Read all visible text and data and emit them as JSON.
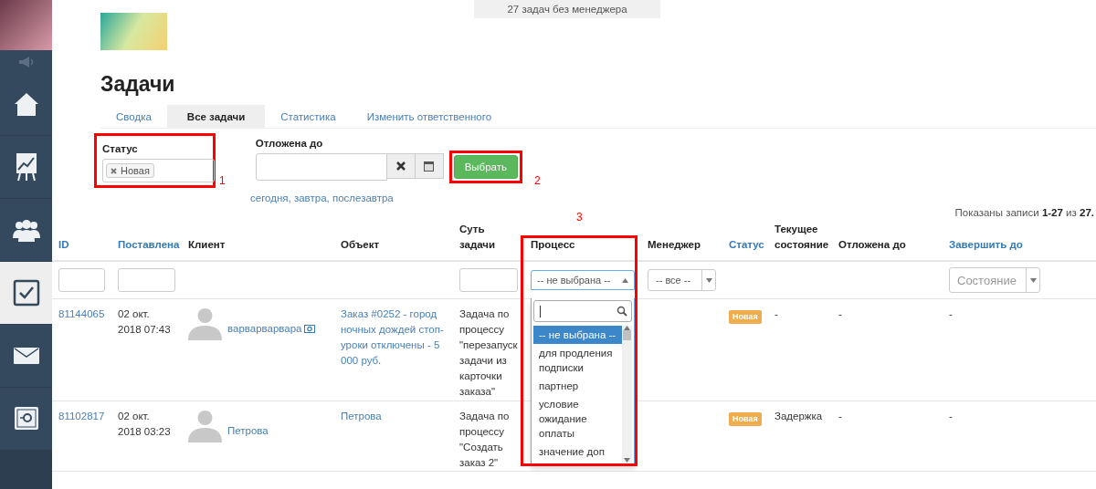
{
  "sidebar": {
    "items": [
      {
        "kind": "home",
        "selected": false
      },
      {
        "kind": "chart",
        "selected": false
      },
      {
        "kind": "people",
        "selected": false
      },
      {
        "kind": "tasks",
        "selected": true
      },
      {
        "kind": "mail",
        "selected": false
      },
      {
        "kind": "safe",
        "selected": false
      }
    ]
  },
  "banner": "27 задач без менеджера",
  "title": "Задачи",
  "tabs": [
    {
      "label": "Сводка",
      "selected": false
    },
    {
      "label": "Все задачи",
      "selected": true
    },
    {
      "label": "Статистика",
      "selected": false
    },
    {
      "label": "Изменить ответственного",
      "selected": false
    }
  ],
  "filters": {
    "status": {
      "label": "Статус",
      "tags": [
        "Новая"
      ]
    },
    "postponed": {
      "label": "Отложена до"
    },
    "button": "Выбрать",
    "quick_links": [
      "сегодня",
      "завтра",
      "послезавтра"
    ],
    "separator": ","
  },
  "records_info": "Показаны записи **1-27** из **27.**",
  "annotations": [
    "1",
    "2",
    "3"
  ],
  "table": {
    "columns": [
      {
        "label": "ID",
        "sortable": true,
        "kind": "input"
      },
      {
        "label": "Поставлена",
        "sortable": true,
        "kind": "input"
      },
      {
        "label": "Клиент",
        "sortable": false,
        "kind": "none"
      },
      {
        "label": "Объект",
        "sortable": false,
        "kind": "none"
      },
      {
        "label": "Суть задачи",
        "sortable": false,
        "kind": "input"
      },
      {
        "label": "Процесс",
        "sortable": false,
        "kind": "dropdown"
      },
      {
        "label": "Менеджер",
        "sortable": false,
        "kind": "select",
        "value": "-- все --"
      },
      {
        "label": "Статус",
        "sortable": true,
        "kind": "none"
      },
      {
        "label": "Текущее состояние",
        "sortable": false,
        "kind": "none"
      },
      {
        "label": "Отложена до",
        "sortable": false,
        "kind": "none"
      },
      {
        "label": "Завершить до",
        "sortable": true,
        "kind": "select",
        "placeholder": "Состояние"
      }
    ],
    "rows": [
      {
        "id": "81144065",
        "placed": "02 окт. 2018 07:43",
        "client": "варварварвара",
        "client_payment_icon": true,
        "object": "Заказ #0252 - город ночных дождей стоп-уроки отключены - 5 000 руб.",
        "essence": "Задача по процессу \"перезапуск задачи из карточки заказа\"",
        "status": {
          "text": "Новая",
          "color": "#f0ad4e"
        },
        "current_state": "-",
        "postponed_until": "-",
        "finish_by": "-"
      },
      {
        "id": "81102817",
        "placed": "02 окт. 2018 03:23",
        "client": "Петрова",
        "client_payment_icon": false,
        "object": "Петрова",
        "essence": "Задача по процессу \"Создать заказ 2\"",
        "status": {
          "text": "Новая",
          "color": "#f0ad4e"
        },
        "current_state": "Задержка",
        "postponed_until": "-",
        "finish_by": "-"
      }
    ]
  },
  "process_dropdown": {
    "value": "-- не выбрана --",
    "options": [
      {
        "label": "-- не выбрана --",
        "selected": true
      },
      {
        "label": "для продления подписки",
        "selected": false
      },
      {
        "label": "партнер",
        "selected": false
      },
      {
        "label": "условие ожидание оплаты",
        "selected": false
      },
      {
        "label": "значение доп",
        "selected": false
      }
    ]
  }
}
